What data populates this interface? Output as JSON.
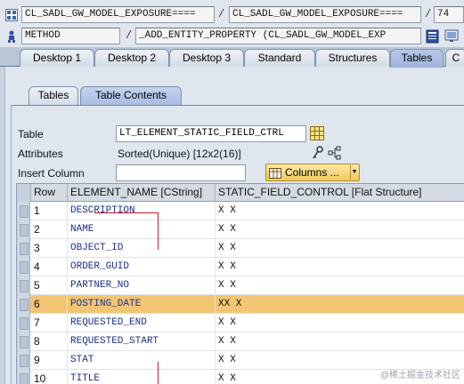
{
  "header": {
    "row1": {
      "class_field": "CL_SADL_GW_MODEL_EXPOSURE====",
      "separator1": "/",
      "class_field2": "CL_SADL_GW_MODEL_EXPOSURE====",
      "separator2": "/",
      "line_number": "74"
    },
    "row2": {
      "type_field": "METHOD",
      "separator": "/",
      "method_field": "_ADD_ENTITY_PROPERTY (CL_SADL_GW_MODEL_EXP"
    }
  },
  "desktop_tabs": [
    {
      "label": "Desktop 1"
    },
    {
      "label": "Desktop 2"
    },
    {
      "label": "Desktop 3"
    },
    {
      "label": "Standard"
    },
    {
      "label": "Structures"
    },
    {
      "label": "Tables"
    },
    {
      "label": "C"
    }
  ],
  "inner_tabs": {
    "tables": "Tables",
    "table_contents": "Table Contents"
  },
  "form": {
    "table_label": "Table",
    "table_value": "LT_ELEMENT_STATIC_FIELD_CTRL",
    "attributes_label": "Attributes",
    "attributes_value": "Sorted(Unique) [12x2(16)]",
    "insert_column_label": "Insert Column",
    "insert_column_value": "",
    "columns_button": "Columns ..."
  },
  "grid": {
    "headers": {
      "row": "Row",
      "element_name": "ELEMENT_NAME [CString]",
      "static_field_control": "STATIC_FIELD_CONTROL [Flat Structure]"
    },
    "rows": [
      {
        "row": "1",
        "element_name": "DESCRIPTION",
        "control": "X X"
      },
      {
        "row": "2",
        "element_name": "NAME",
        "control": "X X"
      },
      {
        "row": "3",
        "element_name": "OBJECT_ID",
        "control": "X X"
      },
      {
        "row": "4",
        "element_name": "ORDER_GUID",
        "control": "X X"
      },
      {
        "row": "5",
        "element_name": "PARTNER_NO",
        "control": "X X"
      },
      {
        "row": "6",
        "element_name": "POSTING_DATE",
        "control": "XX X"
      },
      {
        "row": "7",
        "element_name": "REQUESTED_END",
        "control": "X X"
      },
      {
        "row": "8",
        "element_name": "REQUESTED_START",
        "control": "X X"
      },
      {
        "row": "9",
        "element_name": "STAT",
        "control": "X X"
      },
      {
        "row": "10",
        "element_name": "TITLE",
        "control": "X X"
      }
    ],
    "selected_row_index": 5
  },
  "watermark": "@稀土掘金技术社区",
  "colors": {
    "selected_row": "#f2c574",
    "active_tab": "#a9bde3",
    "annotation_red": "#c9192b",
    "columns_button": "#f0c95c"
  }
}
